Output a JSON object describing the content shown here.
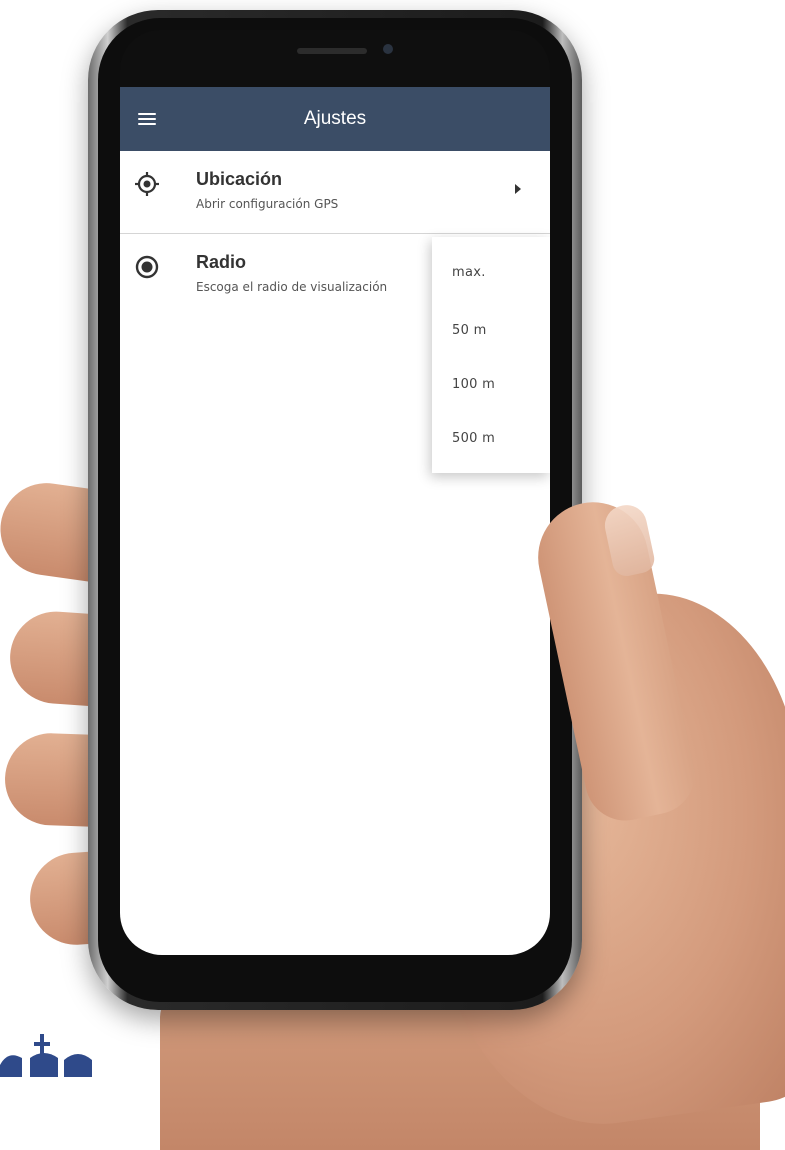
{
  "appbar": {
    "title": "Ajustes",
    "background_color": "#3b4d66",
    "menu_icon": "hamburger-menu-icon"
  },
  "settings": [
    {
      "title": "Ubicación",
      "subtitle": "Abrir configuración GPS",
      "icon": "gps-crosshair-icon",
      "trailing_icon": "chevron-right-icon"
    },
    {
      "title": "Radio",
      "subtitle": "Escoga el radio de visualización",
      "icon": "radio-selected-icon"
    }
  ],
  "dropdown": {
    "options": [
      "max.",
      "50 m",
      "100 m",
      "500 m"
    ]
  },
  "colors": {
    "text_primary": "#333333",
    "text_secondary": "#555555",
    "divider": "#d5d5d5"
  }
}
